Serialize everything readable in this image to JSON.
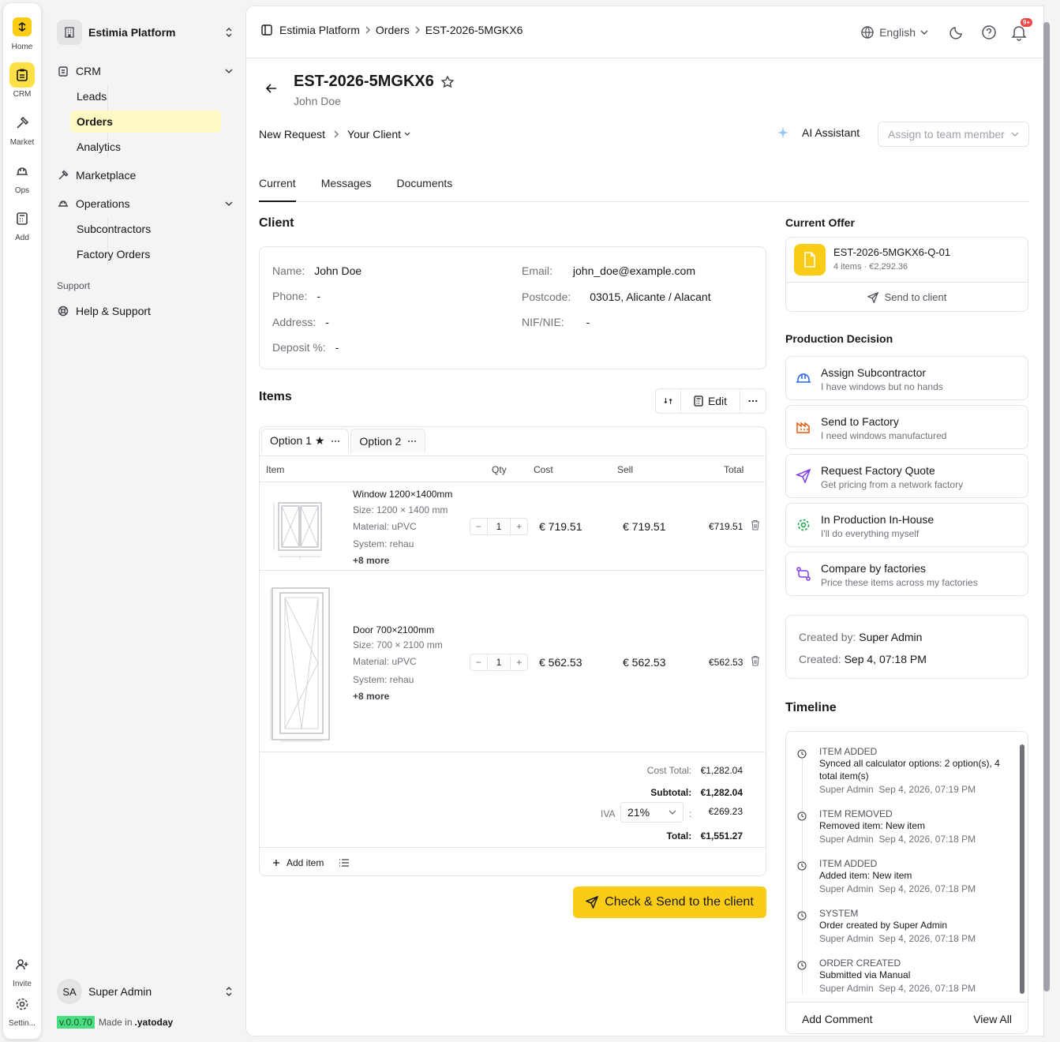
{
  "rail": {
    "items": [
      {
        "label": "Home",
        "icon": "home-icon"
      },
      {
        "label": "CRM",
        "icon": "clipboard-icon"
      },
      {
        "label": "Market",
        "icon": "hammer-icon"
      },
      {
        "label": "Ops",
        "icon": "hard-hat-icon"
      },
      {
        "label": "Add",
        "icon": "calculator-icon"
      }
    ],
    "bottom": [
      {
        "label": "Invite",
        "icon": "user-plus-icon"
      },
      {
        "label": "Settin...",
        "icon": "gear-icon"
      }
    ]
  },
  "sidebar": {
    "workspace": "Estimia Platform",
    "crm": {
      "label": "CRM",
      "items": [
        "Leads",
        "Orders",
        "Analytics"
      ]
    },
    "marketplace": "Marketplace",
    "operations": {
      "label": "Operations",
      "items": [
        "Subcontractors",
        "Factory Orders"
      ]
    },
    "support_group": "Support",
    "help": "Help & Support",
    "user": {
      "initials": "SA",
      "name": "Super Admin"
    },
    "version": "v.0.0.70",
    "made_in": "Made in",
    "brand": ".yatoday"
  },
  "topbar": {
    "breadcrumb": [
      "Estimia Platform",
      "Orders",
      "EST-2026-5MGKX6"
    ],
    "language": "English",
    "notifications": "9+"
  },
  "order": {
    "id": "EST-2026-5MGKX6",
    "client_name": "John Doe",
    "flow": [
      "New Request",
      "Your Client"
    ],
    "ai_assistant": "AI Assistant",
    "assign_placeholder": "Assign to team member"
  },
  "tabs": [
    "Current",
    "Messages",
    "Documents"
  ],
  "client": {
    "heading": "Client",
    "name_label": "Name:",
    "name": "John Doe",
    "phone_label": "Phone:",
    "phone": "-",
    "address_label": "Address:",
    "address": "-",
    "deposit_label": "Deposit %:",
    "deposit": "-",
    "email_label": "Email:",
    "email": "john_doe@example.com",
    "postcode_label": "Postcode:",
    "postcode": "03015, Alicante / Alacant",
    "nif_label": "NIF/NIE:",
    "nif": "-"
  },
  "items": {
    "heading": "Items",
    "edit": "Edit",
    "options": [
      "Option 1 ★",
      "Option 2"
    ],
    "columns": [
      "Item",
      "Qty",
      "Cost",
      "Sell",
      "Total"
    ],
    "rows": [
      {
        "name": "Window 1200×1400mm",
        "size": "Size: 1200 × 1400 mm",
        "material": "Material: uPVC",
        "system": "System: rehau",
        "more": "+8 more",
        "qty": "1",
        "cost": "€ 719.51",
        "sell": "€ 719.51",
        "total": "€719.51"
      },
      {
        "name": "Door 700×2100mm",
        "size": "Size: 700 × 2100 mm",
        "material": "Material: uPVC",
        "system": "System: rehau",
        "more": "+8 more",
        "qty": "1",
        "cost": "€ 562.53",
        "sell": "€ 562.53",
        "total": "€562.53"
      }
    ],
    "cost_total_label": "Cost Total:",
    "cost_total": "€1,282.04",
    "subtotal_label": "Subtotal:",
    "subtotal": "€1,282.04",
    "iva_label": "IVA",
    "iva_rate": "21%",
    "iva_sep": ":",
    "iva": "€269.23",
    "total_label": "Total:",
    "total": "€1,551.27",
    "add_item": "Add item",
    "cta": "Check & Send to the client"
  },
  "offer": {
    "heading": "Current Offer",
    "id": "EST-2026-5MGKX6-Q-01",
    "meta": "4 items · €2,292.36",
    "send": "Send to client"
  },
  "production": {
    "heading": "Production Decision",
    "options": [
      {
        "title": "Assign Subcontractor",
        "desc": "I have windows but no hands",
        "color": "#2563eb"
      },
      {
        "title": "Send to Factory",
        "desc": "I need windows manufactured",
        "color": "#ea580c"
      },
      {
        "title": "Request Factory Quote",
        "desc": "Get pricing from a network factory",
        "color": "#7c3aed"
      },
      {
        "title": "In Production In-House",
        "desc": "I'll do everything myself",
        "color": "#16a34a"
      },
      {
        "title": "Compare by factories",
        "desc": "Price these items across my factories",
        "color": "#7c3aed"
      }
    ]
  },
  "meta": {
    "created_by_label": "Created by:",
    "created_by": "Super Admin",
    "created_label": "Created:",
    "created": "Sep 4, 07:18 PM"
  },
  "timeline": {
    "heading": "Timeline",
    "entries": [
      {
        "kind": "ITEM ADDED",
        "msg": "Synced all calculator options: 2 option(s), 4 total item(s)",
        "who": "Super Admin",
        "when": "Sep 4, 2026, 07:19 PM"
      },
      {
        "kind": "ITEM REMOVED",
        "msg": "Removed item: New item",
        "who": "Super Admin",
        "when": "Sep 4, 2026, 07:18 PM"
      },
      {
        "kind": "ITEM ADDED",
        "msg": "Added item: New item",
        "who": "Super Admin",
        "when": "Sep 4, 2026, 07:18 PM"
      },
      {
        "kind": "SYSTEM",
        "msg": "Order created by Super Admin",
        "who": "Super Admin",
        "when": "Sep 4, 2026, 07:18 PM"
      },
      {
        "kind": "ORDER CREATED",
        "msg": "Submitted via Manual",
        "who": "Super Admin",
        "when": "Sep 4, 2026, 07:18 PM"
      }
    ],
    "add_comment": "Add Comment",
    "view_all": "View All"
  },
  "colors": {
    "accent": "#facc15",
    "accent_soft": "#fef9c3",
    "badge": "#ef4444",
    "version": "#4ade80"
  }
}
